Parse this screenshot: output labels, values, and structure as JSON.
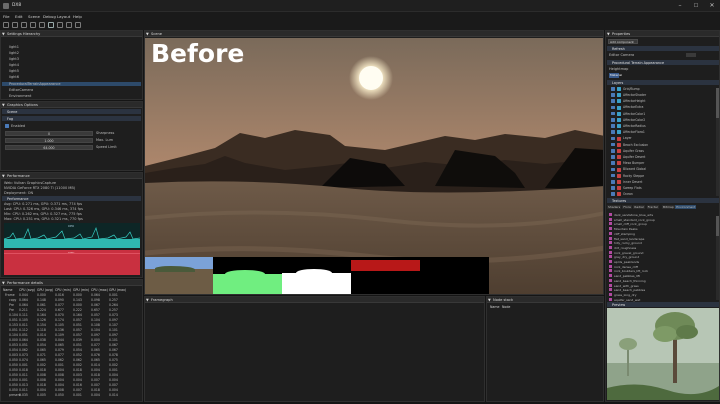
{
  "window": {
    "title": "DX8",
    "min_icon": "minimize-icon",
    "max_icon": "maximize-icon",
    "close_icon": "close-icon"
  },
  "menu": [
    "File",
    "Edit",
    "Scene",
    "Debug",
    "Layout",
    "Help"
  ],
  "settings_panel": {
    "header": "Settings  Hierarchy",
    "items": [
      "light1",
      "light2",
      "light3",
      "light4",
      "light5",
      "light6",
      "ProceduralTerrainAppearance",
      "EditorCamera",
      "Environment"
    ]
  },
  "graphics_panel": {
    "header": "Graphics Options",
    "section_scene": "Scene",
    "section_fog": "Fog",
    "enabled_label": "Enabled",
    "fields": [
      {
        "value": "0",
        "label": "Sharpness"
      },
      {
        "value": "1.000",
        "label": "Max. Lum"
      },
      {
        "value": "64.000",
        "label": "Speed Limit"
      }
    ]
  },
  "performance_panel": {
    "header": "Performance",
    "info_lines": [
      "Web: Vulkan GraphicsCapture",
      "NVIDIA GeForce RTX 2080 Ti (11000 MB)",
      "Deployment: ON"
    ],
    "section": "Performance",
    "stats": [
      "Avg: CPU:   0.271 ms,  GPU:   0.371 ms,   774 fps",
      "Last: CPU:  0.326 ms,  GPU:   0.346 ms,   374 fps",
      "Min: CPU:   0.262 ms,  GPU:   0.327 ms,   775 fps",
      "Max: CPU:   0.251 ms,  GPU:   0.321 ms,   770 fps"
    ],
    "cpu_graph_label": "CPU",
    "gpu_graph_label": "GPU"
  },
  "perf_details": {
    "header": "Performance details",
    "columns": [
      "Name",
      "CPU (avg)",
      "GPU (avg)",
      "CPU (min)",
      "GPU (min)",
      "CPU (max)",
      "GPU (max)"
    ],
    "rows": [
      [
        "Frame",
        "0.044",
        "0.000",
        "0.016",
        "0.000",
        "0.064",
        "0.001"
      ],
      [
        "copy",
        "0.064",
        "0.148",
        "0.090",
        "0.143",
        "0.098",
        "0.257"
      ],
      [
        "Pre",
        "0.064",
        "0.061",
        "0.077",
        "0.000",
        "0.067",
        "0.264"
      ],
      [
        "Pre",
        "0.211",
        "0.224",
        "0.677",
        "0.222",
        "0.657",
        "0.257"
      ],
      [
        "0.104",
        "0.111",
        "0.164",
        "0.070",
        "0.164",
        "0.057",
        "0.073"
      ],
      [
        "0.051",
        "0.105",
        "0.126",
        "0.174",
        "0.057",
        "0.104",
        "0.097"
      ],
      [
        "0.153",
        "0.011",
        "0.154",
        "0.105",
        "0.051",
        "0.108",
        "0.107"
      ],
      [
        "0.051",
        "0.112",
        "0.118",
        "0.136",
        "0.057",
        "0.104",
        "0.101"
      ],
      [
        "0.104",
        "0.051",
        "0.014",
        "0.109",
        "0.057",
        "0.097",
        "0.097"
      ],
      [
        "0.000",
        "0.064",
        "0.038",
        "0.044",
        "0.039",
        "0.000",
        "0.101"
      ],
      [
        "0.053",
        "0.051",
        "0.054",
        "0.065",
        "0.051",
        "0.077",
        "0.067"
      ],
      [
        "0.054",
        "0.062",
        "0.065",
        "0.079",
        "0.054",
        "0.065",
        "0.067"
      ],
      [
        "0.003",
        "0.073",
        "0.071",
        "0.077",
        "0.052",
        "0.076",
        "0.078"
      ],
      [
        "0.050",
        "0.074",
        "0.065",
        "0.062",
        "0.062",
        "0.065",
        "0.075"
      ],
      [
        "0.050",
        "0.001",
        "0.002",
        "0.001",
        "0.002",
        "0.014",
        "0.002"
      ],
      [
        "0.050",
        "0.018",
        "0.018",
        "0.004",
        "0.018",
        "0.004",
        "0.001"
      ],
      [
        "0.050",
        "0.011",
        "0.008",
        "0.008",
        "0.003",
        "0.018",
        "0.004"
      ],
      [
        "0.050",
        "0.001",
        "0.008",
        "0.004",
        "0.004",
        "0.007",
        "0.004"
      ],
      [
        "0.050",
        "0.013",
        "0.018",
        "0.004",
        "0.016",
        "0.007",
        "0.007"
      ],
      [
        "0.050",
        "0.011",
        "0.004",
        "0.008",
        "0.007",
        "0.018",
        "0.004"
      ],
      [
        "present",
        "0.035",
        "0.005",
        "0.050",
        "0.001",
        "0.004",
        "0.014"
      ]
    ]
  },
  "scene": {
    "header": "Scene",
    "overlay_text": "Before"
  },
  "framegraph": {
    "header": "Framegraph"
  },
  "node_stack": {
    "header": "Node stack",
    "cols": [
      "Name",
      "Node"
    ]
  },
  "properties": {
    "header": "Properties",
    "add_component": "Add component",
    "section_refresh": "Refresh",
    "editor_camera": "Editor Camera",
    "terrain_section": "Procedural Terrain Appearance",
    "heightmap": "Heightmap",
    "material_value": "Material",
    "layers_section": "Layers",
    "layers": [
      "Grid/Bump",
      "AffectorShader",
      "AffectorHeight",
      "AffectorExtra",
      "AffectorColor1",
      "AffectorColor2",
      "AffectorRadius",
      "AffectorFlora1",
      "Layer",
      "Beach Exclusion",
      "Aquifer Grass",
      "Aquifer Desert",
      "Mesa Bumper",
      "Blizzard Global",
      "Rocky Steppe",
      "Inner Desert",
      "Sweep Flats",
      "Ocean"
    ],
    "textures_section": "Textures",
    "texture_tabs": [
      "Shaders",
      "Flora",
      "Radial",
      "Fractal",
      "Bitmap",
      "Environment"
    ],
    "textures": [
      "dark_sandstone_blue_arts",
      "small_standard_rock_group",
      "small_cliff_rock_group",
      "Mountain Peaks",
      "cliff_stamping",
      "flat_sand_landscape",
      "hilly_rocky_ground",
      "dirt_roughness",
      "rock_gravel_ground",
      "grey_dry_ground",
      "aprils_peaklands",
      "rock_dense_cliff",
      "rock_boulders_lift_rock",
      "sand_pebbles_lift",
      "sand_beach_thinning",
      "sand_with_grass",
      "sand_beach_pebbles",
      "grass_long_dry",
      "aquifer_sand_wet"
    ],
    "preview_section": "Preview"
  },
  "colors": {
    "accent": "#4a7ab8",
    "cpu_graph": "#2fb8b0",
    "gpu_graph": "#c93040",
    "texture_icon": "#b04aa0"
  }
}
